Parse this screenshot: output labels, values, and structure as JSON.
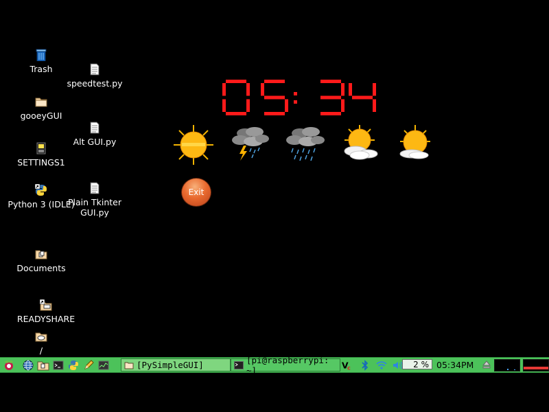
{
  "desktop": {
    "icons": [
      {
        "label": "Trash"
      },
      {
        "label": "speedtest.py"
      },
      {
        "label": "gooeyGUI"
      },
      {
        "label": "Alt GUI.py"
      },
      {
        "label": "SETTINGS1"
      },
      {
        "label": "Python 3 (IDLE)"
      },
      {
        "label": "Plain Tkinter\nGUI.py"
      },
      {
        "label": "Documents"
      },
      {
        "label": "READYSHARE"
      },
      {
        "label": "/"
      }
    ]
  },
  "widget": {
    "clock": "05:34",
    "forecast": [
      "sunny-icon",
      "thunderstorm-icon",
      "rain-icon",
      "partly-cloudy-icon",
      "partly-cloudy-icon"
    ],
    "exit_label": "Exit"
  },
  "taskbar": {
    "tasks": [
      {
        "label": "[PySimpleGUI]",
        "active": true
      },
      {
        "label": "[pi@raspberrypi: ~]",
        "active": false
      }
    ],
    "cpu_label": "2 %",
    "time": "05:34PM",
    "colors": {
      "bar": "#4cc25a",
      "clock_digits": "#ff1a1a"
    }
  }
}
